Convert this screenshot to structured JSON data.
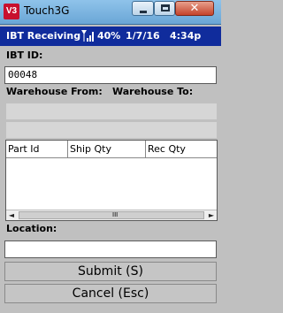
{
  "window": {
    "app_icon": "V3",
    "title": "Touch3G",
    "minimize_icon": "minimize-icon",
    "maximize_icon": "maximize-icon",
    "close_icon": "close-icon"
  },
  "status": {
    "screen": "IBT Receiving",
    "signal_icon": "signal-antenna-icon",
    "battery": "40%",
    "date": "1/7/16",
    "time": "4:34p"
  },
  "form": {
    "ibt_label": "IBT ID:",
    "ibt_value": "00048",
    "warehouse_from_label": "Warehouse From:",
    "warehouse_to_label": "Warehouse To:",
    "location_label": "Location:",
    "location_value": ""
  },
  "grid": {
    "columns": [
      "Part Id",
      "Ship Qty",
      "Rec Qty"
    ],
    "rows": [],
    "scroll_left_icon": "◄",
    "scroll_right_icon": "►",
    "thumb_grip": "III"
  },
  "actions": {
    "submit": "Submit (S)",
    "cancel": "Cancel (Esc)"
  },
  "colors": {
    "status_bar": "#102c9c",
    "background": "#c0c0c0"
  }
}
